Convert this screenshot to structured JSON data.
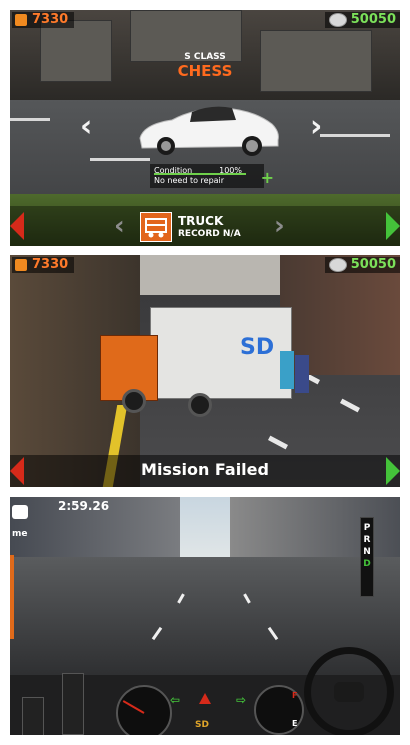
{
  "top_panel": {
    "money": "7330",
    "coins": "50050",
    "vehicle_class": "S CLASS",
    "vehicle_name": "CHESS",
    "condition_label": "Condition",
    "condition_value": "100%",
    "repair_status": "No need to repair",
    "category_name": "TRUCK",
    "category_record": "RECORD N/A"
  },
  "middle_panel": {
    "money": "7330",
    "coins": "50050",
    "status": "Mission Failed",
    "logo": "SD"
  },
  "bottom_panel": {
    "timer": "2:59.26",
    "side_text": "me",
    "gears": [
      "P",
      "R",
      "N",
      "D"
    ],
    "logo": "SD",
    "fuel_full": "F",
    "fuel_empty": "E"
  },
  "colors": {
    "money": "#ff7a2a",
    "coins": "#7be05a",
    "accent_orange": "#e2651c",
    "arrow_red": "#d62a1a",
    "arrow_green": "#44c23a"
  },
  "icons": {
    "money": "coin-icon",
    "coins": "silver-coin-icon",
    "truck": "truck-icon",
    "camera": "camera-icon",
    "warning": "hazard-icon"
  }
}
